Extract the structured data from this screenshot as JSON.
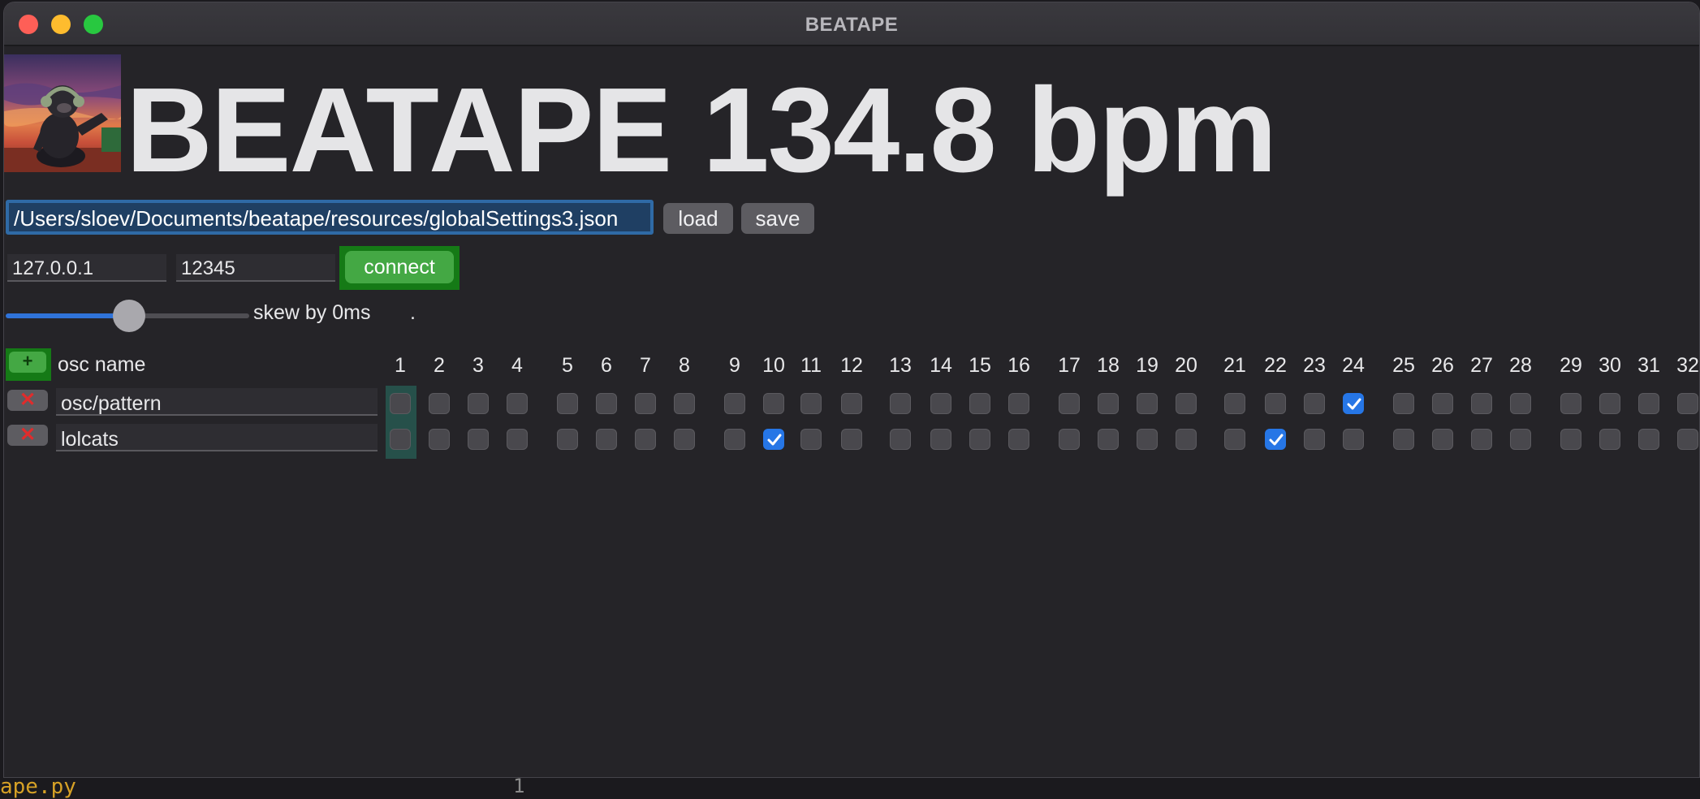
{
  "window": {
    "title": "BEATAPE"
  },
  "header": {
    "title": "BEATAPE 134.8 bpm"
  },
  "file": {
    "path": "/Users/sloev/Documents/beatape/resources/globalSettings3.json",
    "load_label": "load",
    "save_label": "save"
  },
  "connection": {
    "ip": "127.0.0.1",
    "port": "12345",
    "connect_label": "connect"
  },
  "skew": {
    "label": "skew by 0ms",
    "dot": ".",
    "slider_fraction": 0.55
  },
  "grid": {
    "add_label": "+",
    "name_header": "osc name",
    "steps": [
      "1",
      "2",
      "3",
      "4",
      "5",
      "6",
      "7",
      "8",
      "9",
      "10",
      "11",
      "12",
      "13",
      "14",
      "15",
      "16",
      "17",
      "18",
      "19",
      "20",
      "21",
      "22",
      "23",
      "24",
      "25",
      "26",
      "27",
      "28",
      "29",
      "30",
      "31",
      "32"
    ],
    "rows": [
      {
        "name": "osc/pattern",
        "delete_label": "✕",
        "checked_steps": [
          24
        ]
      },
      {
        "name": "lolcats",
        "delete_label": "✕",
        "checked_steps": [
          10,
          22
        ]
      }
    ],
    "current_step": 1,
    "accent": "#2676e6"
  },
  "background_editor": {
    "file_label": "ape.py",
    "line_number": "1"
  }
}
